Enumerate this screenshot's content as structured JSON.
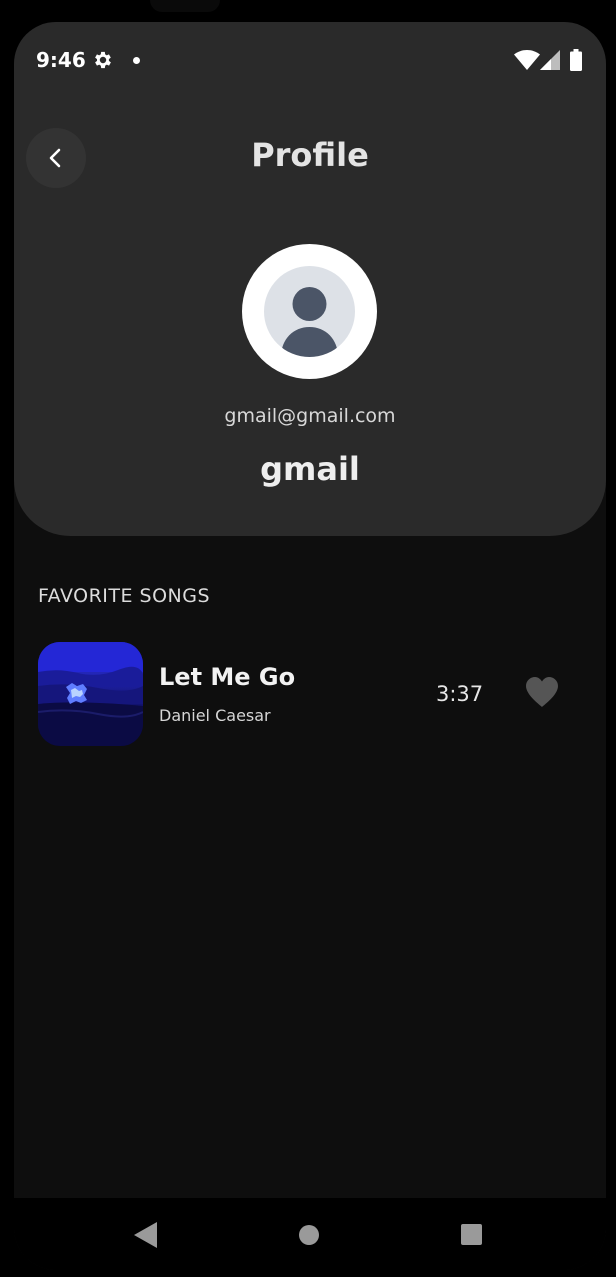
{
  "status_bar": {
    "time": "9:46",
    "icons": [
      "gear-icon",
      "notification-dot-icon",
      "wifi-icon",
      "signal-icon",
      "battery-icon"
    ]
  },
  "header": {
    "back_icon": "chevron-left-icon",
    "title": "Profile"
  },
  "profile": {
    "avatar_icon": "person-placeholder-icon",
    "email": "gmail@gmail.com",
    "username": "gmail"
  },
  "favorites": {
    "section_title": "FAVORITE SONGS",
    "songs": [
      {
        "title": "Let Me Go",
        "artist": "Daniel Caesar",
        "duration": "3:37",
        "favorite_icon": "heart-icon",
        "favorited": true
      }
    ]
  },
  "nav_bar": {
    "icons": [
      "back-triangle-icon",
      "home-circle-icon",
      "recents-square-icon"
    ]
  },
  "colors": {
    "background": "#0e0e0e",
    "header_card": "#2a2a2a",
    "text_primary": "#eeeeee",
    "heart": "#555555"
  }
}
